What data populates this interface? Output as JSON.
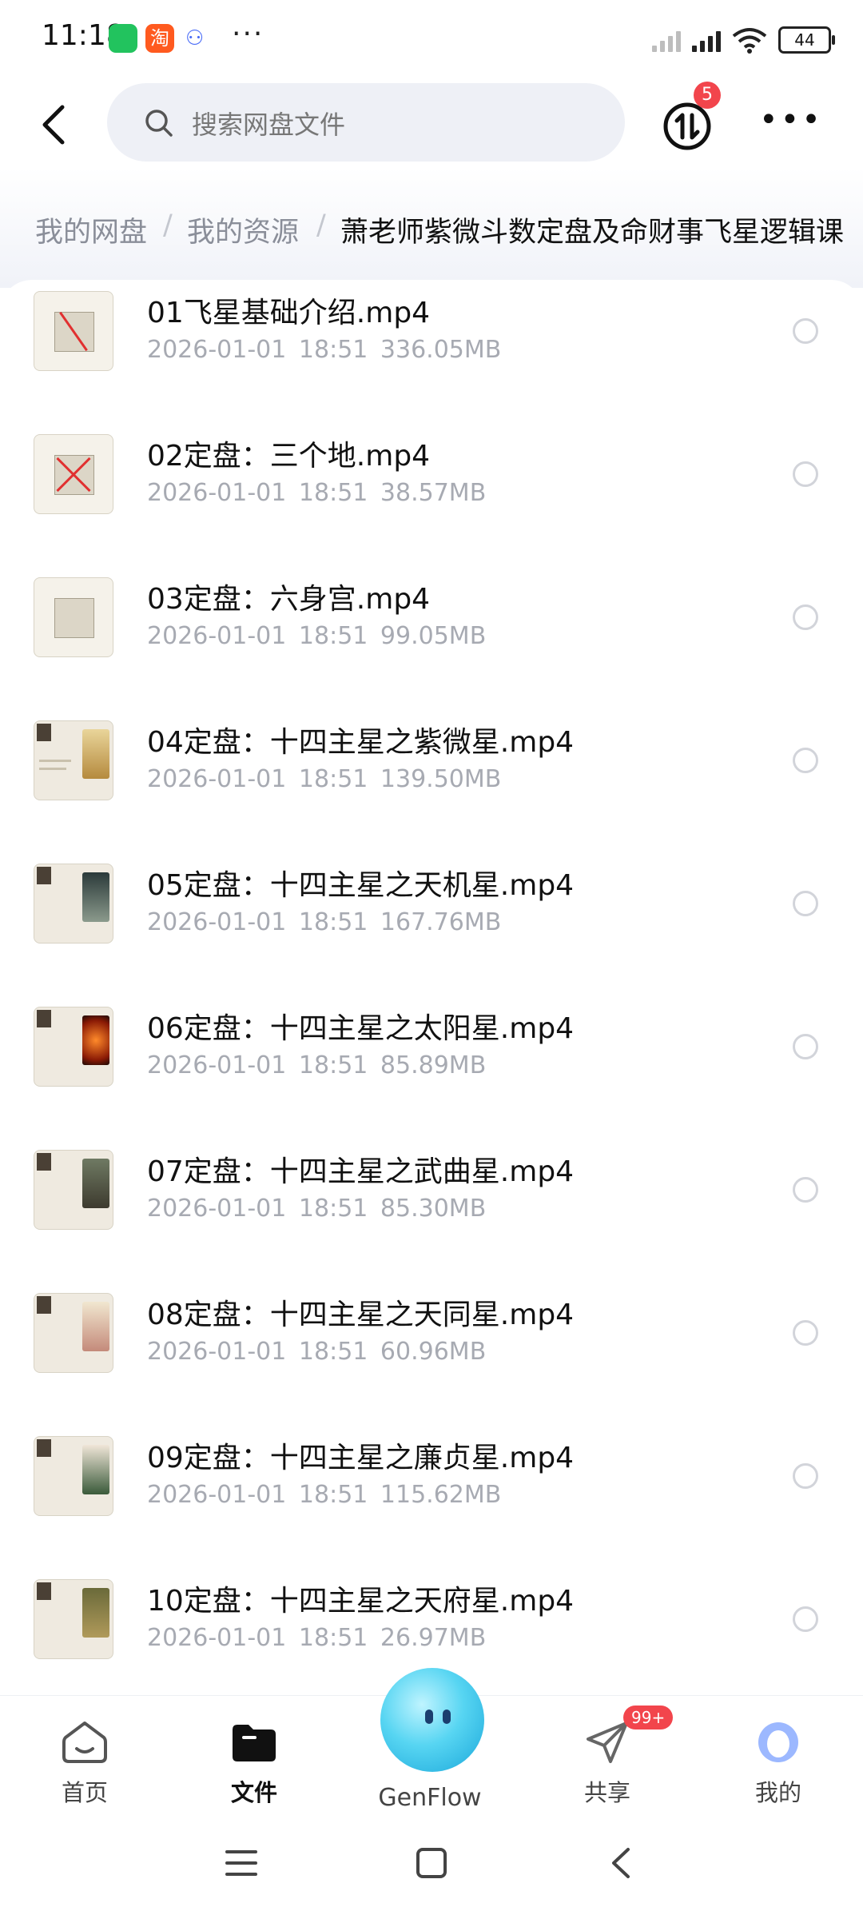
{
  "status_bar": {
    "time": "11:18",
    "taobao_glyph": "淘",
    "battery": "44"
  },
  "search": {
    "placeholder": "搜索网盘文件"
  },
  "transfer_badge": "5",
  "breadcrumb": [
    "我的网盘",
    "我的资源",
    "萧老师紫微斗数定盘及命财事飞星逻辑课"
  ],
  "files": [
    {
      "name": "01飞星基础介绍.mp4",
      "date": "2026-01-01",
      "time": "18:51",
      "size": "336.05MB"
    },
    {
      "name": "02定盘：三个地.mp4",
      "date": "2026-01-01",
      "time": "18:51",
      "size": "38.57MB"
    },
    {
      "name": "03定盘：六身宫.mp4",
      "date": "2026-01-01",
      "time": "18:51",
      "size": "99.05MB"
    },
    {
      "name": "04定盘：十四主星之紫微星.mp4",
      "date": "2026-01-01",
      "time": "18:51",
      "size": "139.50MB"
    },
    {
      "name": "05定盘：十四主星之天机星.mp4",
      "date": "2026-01-01",
      "time": "18:51",
      "size": "167.76MB"
    },
    {
      "name": "06定盘：十四主星之太阳星.mp4",
      "date": "2026-01-01",
      "time": "18:51",
      "size": "85.89MB"
    },
    {
      "name": "07定盘：十四主星之武曲星.mp4",
      "date": "2026-01-01",
      "time": "18:51",
      "size": "85.30MB"
    },
    {
      "name": "08定盘：十四主星之天同星.mp4",
      "date": "2026-01-01",
      "time": "18:51",
      "size": "60.96MB"
    },
    {
      "name": "09定盘：十四主星之廉贞星.mp4",
      "date": "2026-01-01",
      "time": "18:51",
      "size": "115.62MB"
    },
    {
      "name": "10定盘：十四主星之天府星.mp4",
      "date": "2026-01-01",
      "time": "18:51",
      "size": "26.97MB"
    }
  ],
  "bottom_nav": {
    "home": "首页",
    "files": "文件",
    "genflow": "GenFlow",
    "share": "共享",
    "share_badge": "99+",
    "me": "我的"
  },
  "colors": {
    "accent_badge": "#f2454c",
    "genflow": "#57d5f2"
  }
}
